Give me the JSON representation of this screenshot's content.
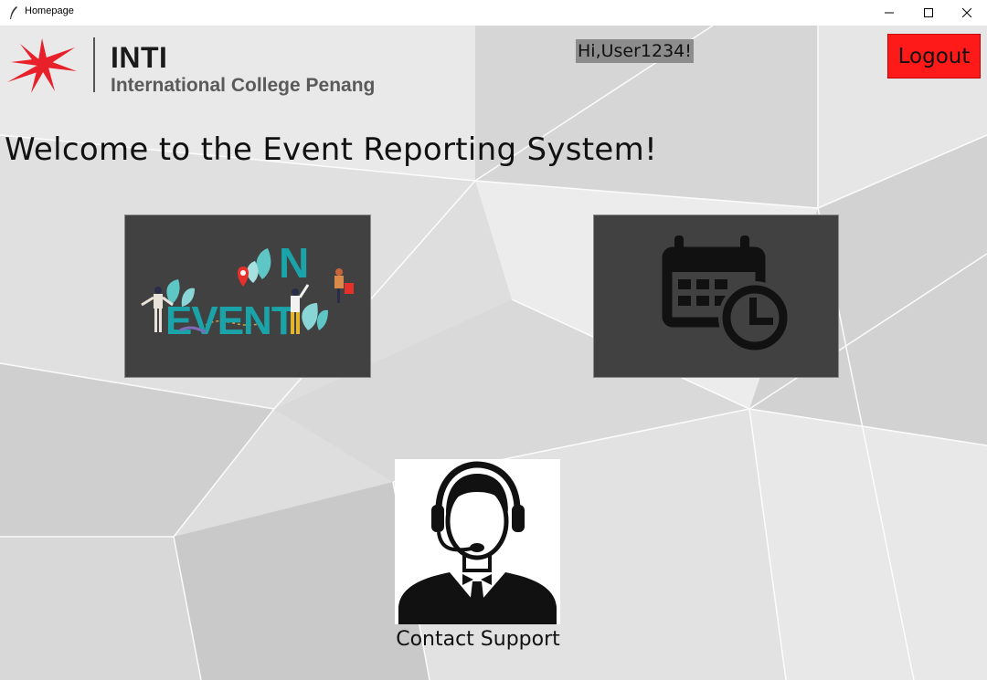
{
  "window": {
    "title": "Homepage"
  },
  "header": {
    "logo_brand": "INTI",
    "logo_subtitle": "International College Penang",
    "greeting": "Hi,User1234!",
    "logout_label": "Logout"
  },
  "main": {
    "welcome_text": "Welcome to the Event Reporting System!",
    "tiles": [
      {
        "icon": "event-illustration-icon",
        "text": "EVENT"
      },
      {
        "icon": "calendar-clock-icon"
      }
    ],
    "support": {
      "icon": "headset-agent-icon",
      "label": "Contact Support"
    }
  },
  "colors": {
    "logout_bg": "#ff1a1a",
    "tile_bg": "#414141",
    "greeting_bg": "#8c8c8c",
    "inti_red": "#e8202a"
  }
}
